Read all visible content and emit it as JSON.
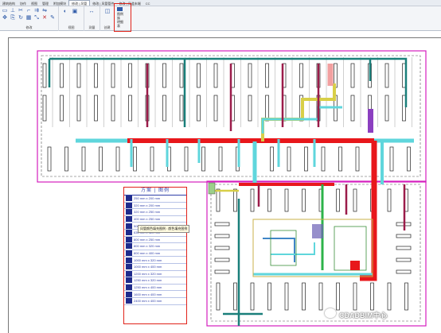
{
  "menubar": {
    "items": [
      "建筑结构",
      "协作",
      "视图",
      "管理",
      "附加模块",
      "修改 | 风管",
      "修改 | 风管管件",
      "修改 | 风道末端",
      "CC"
    ]
  },
  "ribbon": {
    "groups": [
      {
        "label": "修改"
      },
      {
        "label": "视图"
      },
      {
        "label": "测量"
      },
      {
        "label": "创建"
      }
    ],
    "highlighted_tool": {
      "lines": [
        "图例",
        "族",
        "明细",
        "表"
      ]
    }
  },
  "legend": {
    "title": "方案 | 图例",
    "rows": [
      "250 mm x 200 mm",
      "320 mm x 200 mm",
      "320 mm x 250 mm",
      "400 mm x 250 mm",
      "500 mm x 200 mm",
      "630 mm x 320 mm",
      "800 mm x 250 mm",
      "800 mm x 320 mm",
      "800 mm x 400 mm",
      "1000 mm x 320 mm",
      "1000 mm x 400 mm",
      "1200 mm x 320 mm",
      "1250 mm x 320 mm",
      "1250 mm x 400 mm",
      "1600 mm x 400 mm",
      "2400 mm x 400 mm"
    ]
  },
  "tooltip": {
    "text": "风管颜色填充图例 : 颜色填充图例"
  },
  "watermark": {
    "text": "CDADBIM中心"
  },
  "colors": {
    "duct_red": "#e8171b",
    "duct_cyan": "#5fd6dc",
    "duct_teal": "#1a7f7a",
    "duct_maroon": "#9b1c4a",
    "duct_green": "#2db34a",
    "duct_yellow": "#d8cf48",
    "legend_blue": "#1f2b8c",
    "highlight": "#e1231a",
    "boundary": "#d41fbf"
  }
}
